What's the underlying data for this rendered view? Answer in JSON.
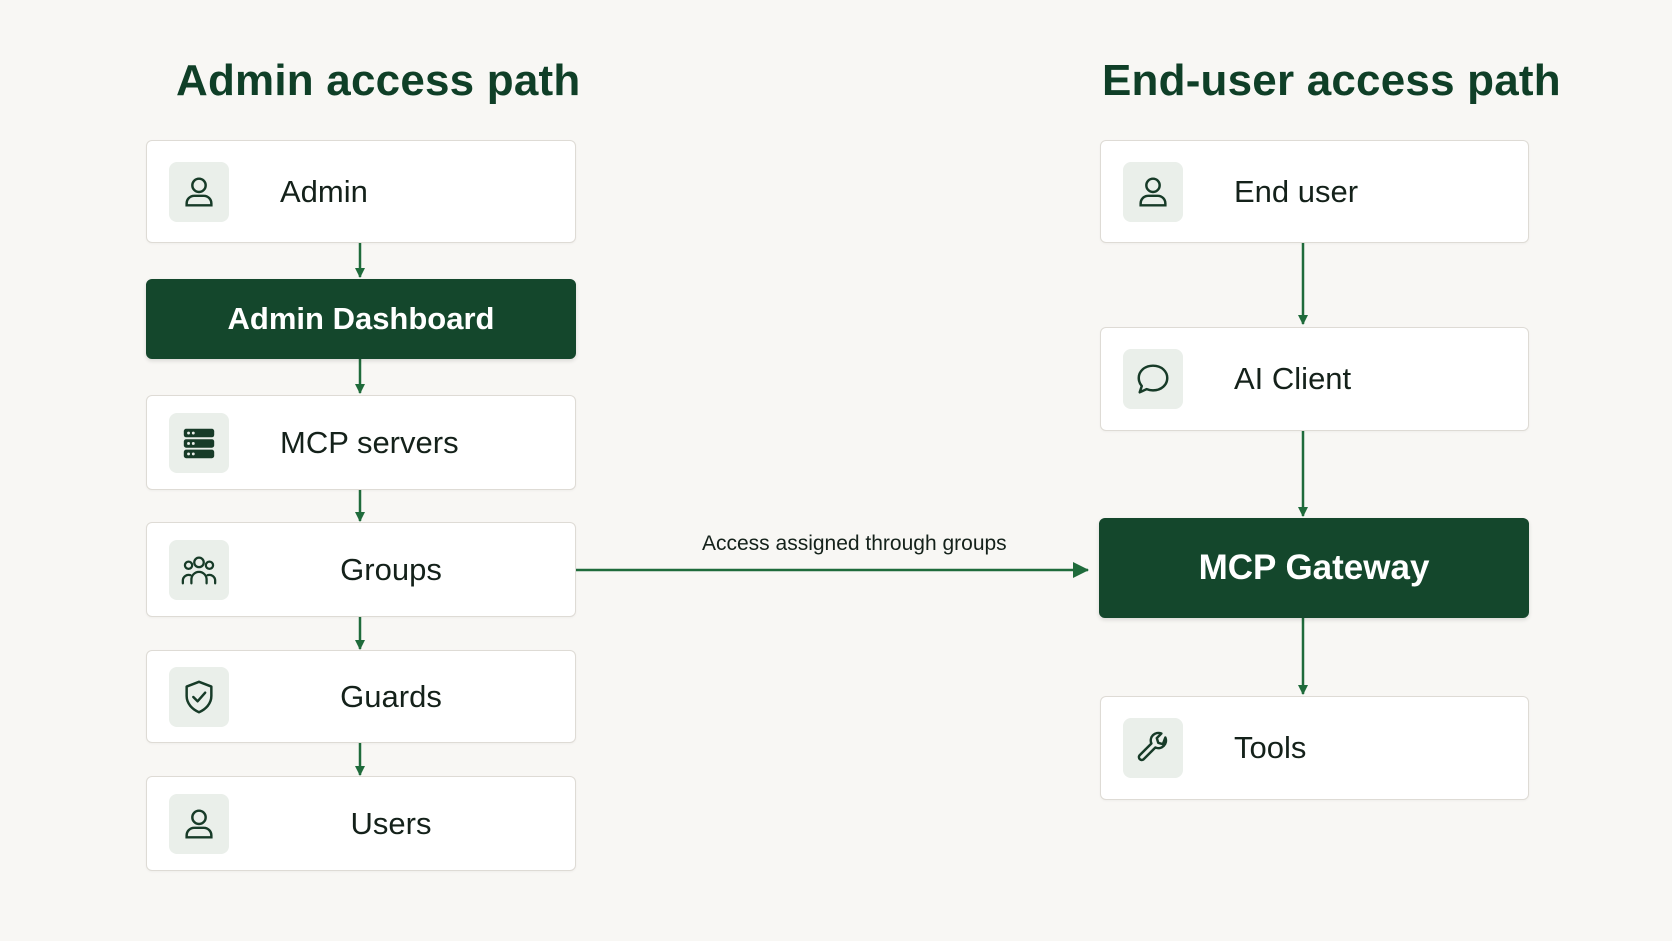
{
  "admin_path": {
    "title": "Admin access path",
    "admin": "Admin",
    "dashboard": "Admin Dashboard",
    "mcp_servers": "MCP servers",
    "groups": "Groups",
    "guards": "Guards",
    "users": "Users"
  },
  "end_user_path": {
    "title": "End-user access path",
    "end_user": "End user",
    "ai_client": "AI Client",
    "gateway": "MCP Gateway",
    "tools": "Tools"
  },
  "connector": {
    "label": "Access assigned through groups"
  },
  "icons": {
    "admin": "user-icon",
    "mcp_servers": "server-stack-icon",
    "groups": "group-icon",
    "guards": "shield-check-icon",
    "users": "user-icon",
    "end_user": "user-icon",
    "ai_client": "chat-bubble-icon",
    "tools": "wrench-icon"
  },
  "colors": {
    "accent_dark": "#14472c",
    "arrow": "#1f6b3b",
    "background": "#f8f7f4",
    "title": "#0f3f27"
  }
}
